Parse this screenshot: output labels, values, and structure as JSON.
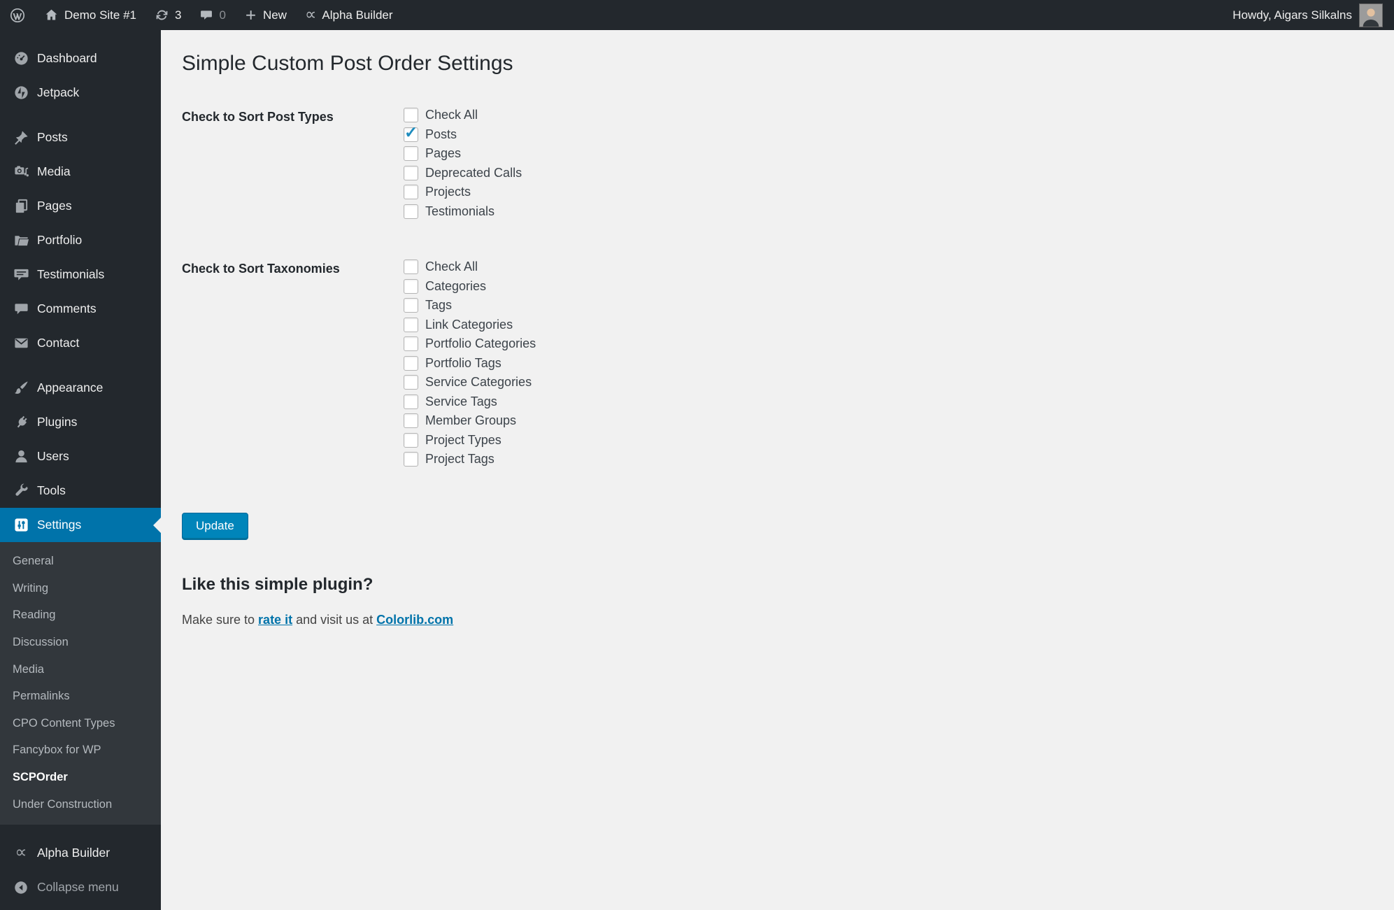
{
  "colors": {
    "admin_bar_bg": "#23282d",
    "submenu_bg": "#32373c",
    "active_menu_blue": "#0073aa",
    "button_blue": "#0085ba",
    "link_blue": "#0073aa",
    "checkmark_blue": "#1e8cbe",
    "content_bg": "#f1f1f1"
  },
  "admin_bar": {
    "logo_icon": "wordpress-logo-icon",
    "site_name": "Demo Site #1",
    "update_count": "3",
    "comment_count": "0",
    "new_label": "New",
    "builder_label": "Alpha Builder",
    "howdy": "Howdy, Aigars Silkalns",
    "avatar_icon": "user-avatar"
  },
  "sidebar": {
    "items": [
      {
        "icon": "dashboard-icon",
        "label": "Dashboard"
      },
      {
        "icon": "jetpack-icon",
        "label": "Jetpack"
      },
      {
        "icon": "pin-icon",
        "label": "Posts"
      },
      {
        "icon": "media-icon",
        "label": "Media"
      },
      {
        "icon": "pages-icon",
        "label": "Pages"
      },
      {
        "icon": "portfolio-folder-icon",
        "label": "Portfolio"
      },
      {
        "icon": "testimonials-icon",
        "label": "Testimonials"
      },
      {
        "icon": "comments-icon",
        "label": "Comments"
      },
      {
        "icon": "envelope-icon",
        "label": "Contact"
      },
      {
        "icon": "appearance-brush-icon",
        "label": "Appearance"
      },
      {
        "icon": "plugins-icon",
        "label": "Plugins"
      },
      {
        "icon": "users-icon",
        "label": "Users"
      },
      {
        "icon": "tools-wrench-icon",
        "label": "Tools"
      },
      {
        "icon": "settings-sliders-icon",
        "label": "Settings"
      }
    ],
    "settings_submenu": [
      {
        "label": "General"
      },
      {
        "label": "Writing"
      },
      {
        "label": "Reading"
      },
      {
        "label": "Discussion"
      },
      {
        "label": "Media"
      },
      {
        "label": "Permalinks"
      },
      {
        "label": "CPO Content Types"
      },
      {
        "label": "Fancybox for WP"
      },
      {
        "label": "SCPOrder",
        "current": true
      },
      {
        "label": "Under Construction"
      }
    ],
    "builder_label": "Alpha Builder",
    "collapse_label": "Collapse menu"
  },
  "main": {
    "title": "Simple Custom Post Order Settings",
    "post_types": {
      "label": "Check to Sort Post Types",
      "items": [
        {
          "label": "Check All",
          "checked": false
        },
        {
          "label": "Posts",
          "checked": true
        },
        {
          "label": "Pages",
          "checked": false
        },
        {
          "label": "Deprecated Calls",
          "checked": false
        },
        {
          "label": "Projects",
          "checked": false
        },
        {
          "label": "Testimonials",
          "checked": false
        }
      ]
    },
    "taxonomies": {
      "label": "Check to Sort Taxonomies",
      "items": [
        {
          "label": "Check All",
          "checked": false
        },
        {
          "label": "Categories",
          "checked": false
        },
        {
          "label": "Tags",
          "checked": false
        },
        {
          "label": "Link Categories",
          "checked": false
        },
        {
          "label": "Portfolio Categories",
          "checked": false
        },
        {
          "label": "Portfolio Tags",
          "checked": false
        },
        {
          "label": "Service Categories",
          "checked": false
        },
        {
          "label": "Service Tags",
          "checked": false
        },
        {
          "label": "Member Groups",
          "checked": false
        },
        {
          "label": "Project Types",
          "checked": false
        },
        {
          "label": "Project Tags",
          "checked": false
        }
      ]
    },
    "update_button": "Update",
    "promo": {
      "heading": "Like this simple plugin?",
      "text_before": "Make sure to ",
      "rate_link": "rate it",
      "text_middle": " and visit us at ",
      "site_link": "Colorlib.com"
    }
  }
}
